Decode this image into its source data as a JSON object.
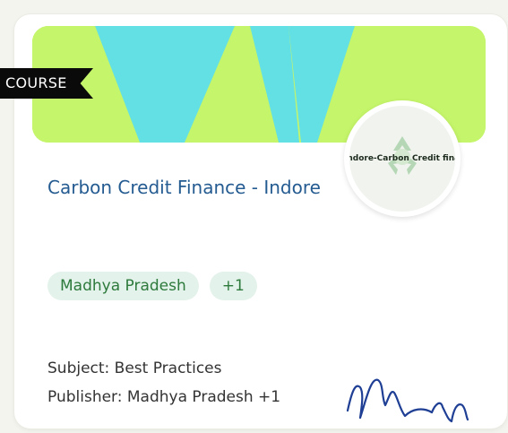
{
  "card": {
    "badge": "COURSE",
    "logo_text": "Indore-Carbon Credit finance",
    "title": "Carbon Credit Finance - Indore",
    "tags": [
      "Madhya Pradesh",
      "+1"
    ],
    "subject_line": "Subject: Best Practices",
    "publisher_line": "Publisher: Madhya Pradesh +1"
  },
  "colors": {
    "banner_green": "#c5f56a",
    "banner_cyan": "#63e0e3",
    "title_blue": "#245b91",
    "tag_bg": "#e3f2ea",
    "tag_text": "#2d7a3c",
    "signature_blue": "#1f3f95"
  },
  "icons": {
    "banner": "banner-art",
    "logo": "recycle-icon",
    "signature": "signature-scribble"
  }
}
